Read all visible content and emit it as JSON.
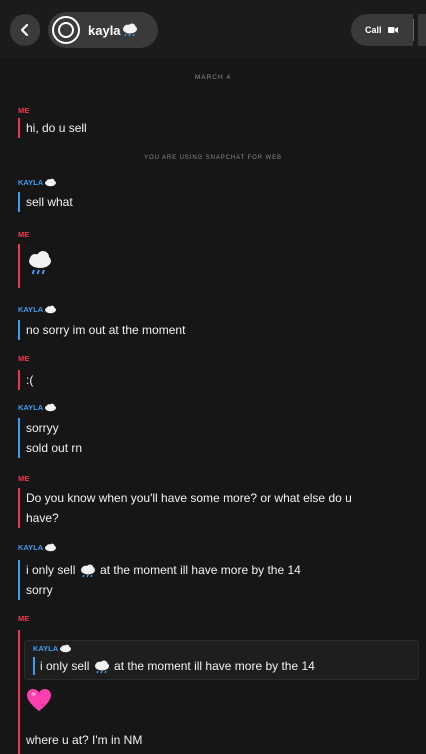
{
  "header": {
    "username": "kayla",
    "call_label": "Call"
  },
  "chat": {
    "date": "MARCH 4",
    "notice": "YOU ARE USING SNAPCHAT FOR WEB",
    "sender_me": "ME",
    "sender_kayla": "KAYLA",
    "messages": [
      "hi, do u sell",
      "sell what",
      "no sorry im out at the moment",
      ":(",
      "sorryy",
      "sold out rn",
      "Do you know when you'll have some more? or what else do u",
      "have?",
      "i only sell",
      "at the moment ill have more by the 14",
      "sorry",
      "i only sell",
      "at the moment ill have more by the 14",
      "where u at? I'm in NM"
    ]
  },
  "colors": {
    "me": "#f0354f",
    "kayla": "#3c9ef3",
    "background": "#161616"
  },
  "icons": [
    "back-chevron-icon",
    "avatar-icon",
    "cloud-emoji-icon",
    "video-camera-icon",
    "heart-emoji-icon"
  ]
}
